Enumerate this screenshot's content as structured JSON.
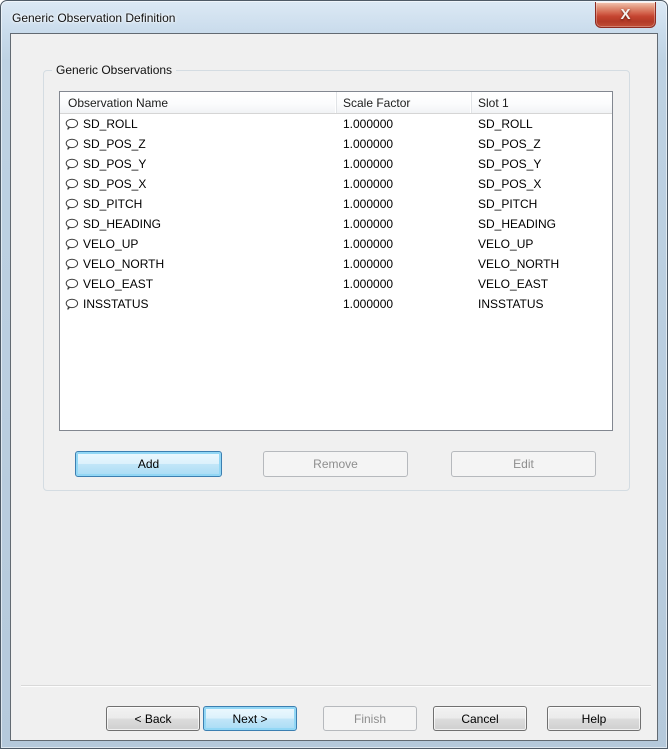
{
  "window": {
    "title": "Generic Observation Definition",
    "close_glyph": "X"
  },
  "content": {
    "groupbox_label": "Generic Observations",
    "table": {
      "columns": [
        "Observation Name",
        "Scale Factor",
        "Slot 1"
      ],
      "rows": [
        {
          "name": "SD_ROLL",
          "scale_factor": "1.000000",
          "slot1": "SD_ROLL"
        },
        {
          "name": "SD_POS_Z",
          "scale_factor": "1.000000",
          "slot1": "SD_POS_Z"
        },
        {
          "name": "SD_POS_Y",
          "scale_factor": "1.000000",
          "slot1": "SD_POS_Y"
        },
        {
          "name": "SD_POS_X",
          "scale_factor": "1.000000",
          "slot1": "SD_POS_X"
        },
        {
          "name": "SD_PITCH",
          "scale_factor": "1.000000",
          "slot1": "SD_PITCH"
        },
        {
          "name": "SD_HEADING",
          "scale_factor": "1.000000",
          "slot1": "SD_HEADING"
        },
        {
          "name": "VELO_UP",
          "scale_factor": "1.000000",
          "slot1": "VELO_UP"
        },
        {
          "name": "VELO_NORTH",
          "scale_factor": "1.000000",
          "slot1": "VELO_NORTH"
        },
        {
          "name": "VELO_EAST",
          "scale_factor": "1.000000",
          "slot1": "VELO_EAST"
        },
        {
          "name": "INSSTATUS",
          "scale_factor": "1.000000",
          "slot1": "INSSTATUS"
        }
      ]
    },
    "list_buttons": {
      "add": "Add",
      "remove": "Remove",
      "edit": "Edit"
    },
    "wizard_buttons": {
      "back": "< Back",
      "next": "Next >",
      "finish": "Finish",
      "cancel": "Cancel",
      "help": "Help"
    }
  },
  "colors": {
    "focus_accent": "#3c7fb1",
    "close_button_red": "#c2402c",
    "title_bar_blue": "#c8d8e8",
    "disabled_text": "#8e8e8e",
    "dialog_body": "#f0f0f0"
  }
}
